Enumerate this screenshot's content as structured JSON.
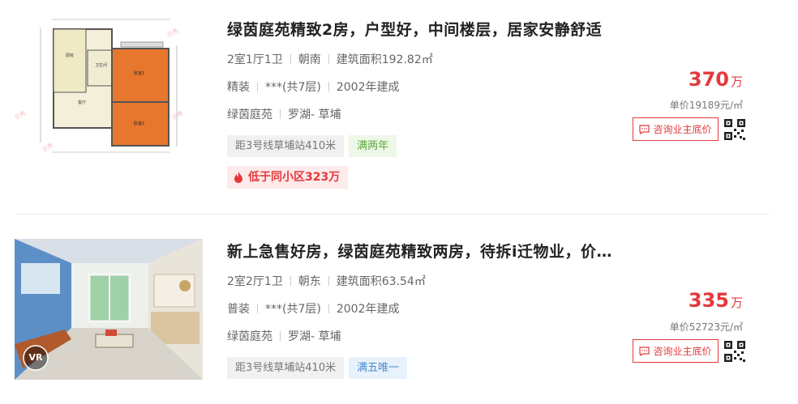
{
  "listings": [
    {
      "title": "绿茵庭苑精致2房，户型好，中间楼层，居家安静舒适",
      "layout": "2室1厅1卫",
      "orientation": "朝南",
      "area": "建筑面积192.82㎡",
      "decoration": "精装",
      "floor": "***(共7层)",
      "built": "2002年建成",
      "community": "绿茵庭苑",
      "district": "罗湖- 草埔",
      "tags": [
        "距3号线草埔站410米",
        "满两年"
      ],
      "hot": "低于同小区323万",
      "price": "370",
      "price_unit": "万",
      "unit_price": "单价19189元/㎡",
      "consult": "咨询业主底价"
    },
    {
      "title": "新上急售好房，绿茵庭苑精致两房，待拆i迁物业，价…",
      "layout": "2室2厅1卫",
      "orientation": "朝东",
      "area": "建筑面积63.54㎡",
      "decoration": "普装",
      "floor": "***(共7层)",
      "built": "2002年建成",
      "community": "绿茵庭苑",
      "district": "罗湖- 草埔",
      "tags": [
        "距3号线草埔站410米",
        "满五唯一"
      ],
      "vr": "VR",
      "price": "335",
      "price_unit": "万",
      "unit_price": "单价52723元/㎡",
      "consult": "咨询业主底价"
    }
  ],
  "colors": {
    "accent": "#e4393c",
    "green_tag": "#5aa83c",
    "blue_tag": "#4a8ad0"
  },
  "icons": [
    "floorplan-image",
    "room-photo",
    "fire-icon",
    "chat-icon",
    "qr-code-icon",
    "vr-badge"
  ]
}
